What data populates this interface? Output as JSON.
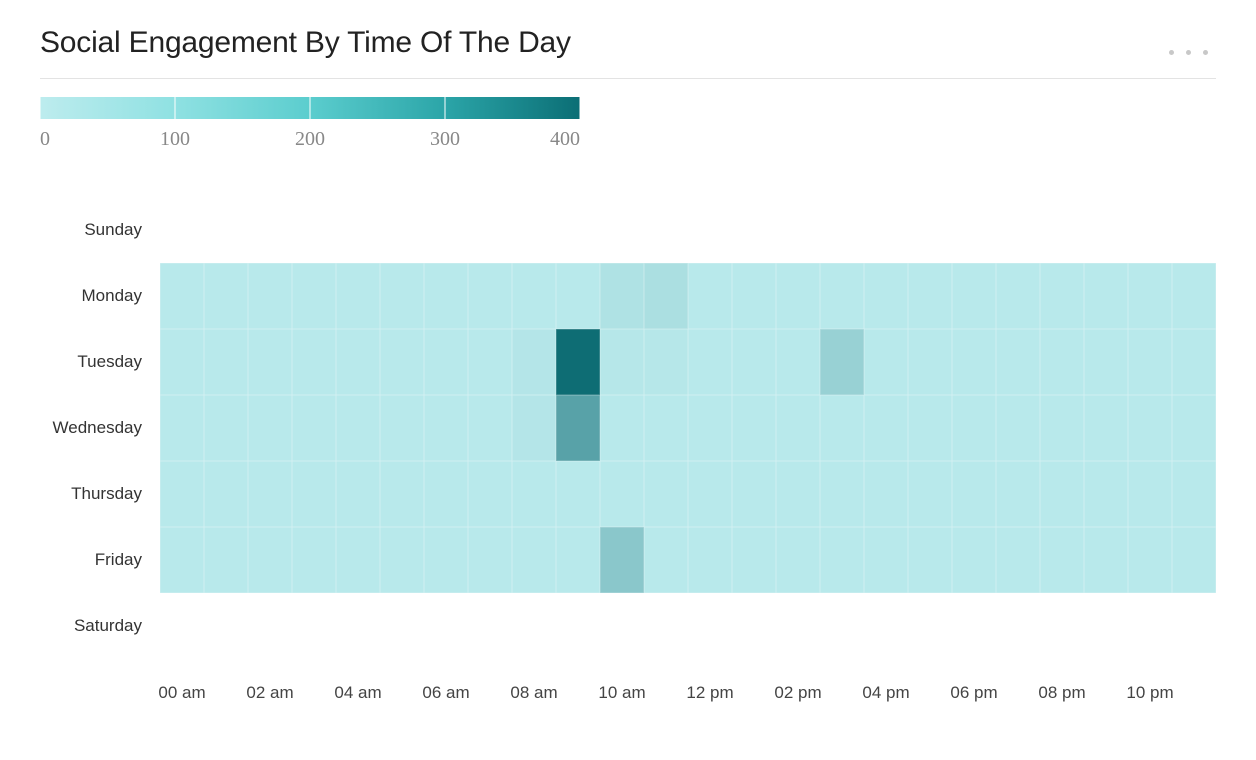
{
  "header": {
    "title": "Social Engagement By Time Of The Day"
  },
  "legend": {
    "ticks": [
      "0",
      "100",
      "200",
      "300",
      "400"
    ]
  },
  "chart_data": {
    "type": "heatmap",
    "title": "Social Engagement By Time Of The Day",
    "xlabel": "",
    "ylabel": "",
    "y_categories": [
      "Sunday",
      "Monday",
      "Tuesday",
      "Wednesday",
      "Thursday",
      "Friday",
      "Saturday"
    ],
    "x_categories": [
      "00 am",
      "01 am",
      "02 am",
      "03 am",
      "04 am",
      "05 am",
      "06 am",
      "07 am",
      "08 am",
      "09 am",
      "10 am",
      "11 am",
      "12 pm",
      "01 pm",
      "02 pm",
      "03 pm",
      "04 pm",
      "05 pm",
      "06 pm",
      "07 pm",
      "08 pm",
      "09 pm",
      "10 pm",
      "11 pm"
    ],
    "x_tick_labels": [
      "00 am",
      "02 am",
      "04 am",
      "06 am",
      "08 am",
      "10 am",
      "12 pm",
      "02 pm",
      "04 pm",
      "06 pm",
      "08 pm",
      "10 pm"
    ],
    "color_scale": {
      "min": 0,
      "max": 400,
      "colors": [
        "#bdecee",
        "#05666e"
      ]
    },
    "values": [
      [
        null,
        null,
        null,
        null,
        null,
        null,
        null,
        null,
        null,
        null,
        null,
        null,
        null,
        null,
        null,
        null,
        null,
        null,
        null,
        null,
        null,
        null,
        null,
        null
      ],
      [
        10,
        10,
        10,
        10,
        10,
        10,
        10,
        10,
        10,
        10,
        30,
        40,
        10,
        10,
        10,
        10,
        10,
        10,
        10,
        10,
        10,
        10,
        10,
        10
      ],
      [
        10,
        10,
        10,
        10,
        10,
        10,
        10,
        10,
        20,
        380,
        15,
        15,
        10,
        10,
        10,
        80,
        10,
        10,
        10,
        10,
        10,
        10,
        10,
        10
      ],
      [
        10,
        10,
        10,
        10,
        10,
        10,
        10,
        10,
        20,
        220,
        10,
        10,
        10,
        10,
        10,
        10,
        10,
        10,
        10,
        10,
        10,
        10,
        10,
        10
      ],
      [
        10,
        10,
        10,
        10,
        10,
        10,
        10,
        10,
        10,
        10,
        10,
        10,
        10,
        10,
        10,
        10,
        10,
        10,
        10,
        10,
        10,
        10,
        10,
        10
      ],
      [
        10,
        10,
        10,
        10,
        10,
        10,
        10,
        10,
        10,
        10,
        110,
        10,
        10,
        10,
        10,
        10,
        10,
        10,
        10,
        10,
        10,
        10,
        10,
        10
      ],
      [
        null,
        null,
        null,
        null,
        null,
        null,
        null,
        null,
        null,
        null,
        null,
        null,
        null,
        null,
        null,
        null,
        null,
        null,
        null,
        null,
        null,
        null,
        null,
        null
      ]
    ],
    "legend": {
      "ticks": [
        0,
        100,
        200,
        300,
        400
      ]
    }
  }
}
